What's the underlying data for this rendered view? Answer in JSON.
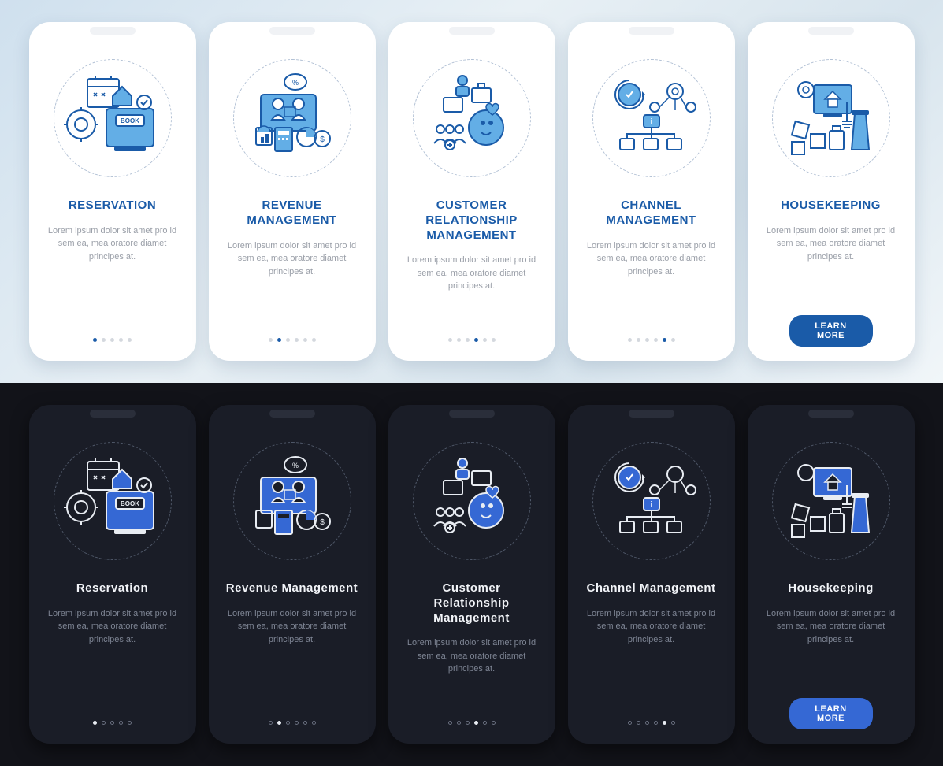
{
  "colors": {
    "accent": "#1a5ba8",
    "accentDark": "#3568d4"
  },
  "cards": [
    {
      "id": "reservation",
      "title_light": "RESERVATION",
      "title_dark": "Reservation",
      "desc": "Lorem ipsum dolor sit amet pro id sem ea, mea oratore diamet principes at.",
      "dots": 5,
      "active": 0,
      "cta": false
    },
    {
      "id": "revenue",
      "title_light": "REVENUE MANAGEMENT",
      "title_dark": "Revenue Management",
      "desc": "Lorem ipsum dolor sit amet pro id sem ea, mea oratore diamet principes at.",
      "dots": 6,
      "active": 1,
      "cta": false
    },
    {
      "id": "crm",
      "title_light": "CUSTOMER RELATIONSHIP MANAGEMENT",
      "title_dark": "Customer Relationship Management",
      "desc": "Lorem ipsum dolor sit amet pro id sem ea, mea oratore diamet principes at.",
      "dots": 6,
      "active": 3,
      "cta": false
    },
    {
      "id": "channel",
      "title_light": "CHANNEL MANAGEMENT",
      "title_dark": "Channel Management",
      "desc": "Lorem ipsum dolor sit amet pro id sem ea, mea oratore diamet principes at.",
      "dots": 6,
      "active": 4,
      "cta": false
    },
    {
      "id": "housekeeping",
      "title_light": "HOUSEKEEPING",
      "title_dark": "Housekeeping",
      "desc": "Lorem ipsum dolor sit amet pro id sem ea, mea oratore diamet principes at.",
      "dots": 0,
      "active": -1,
      "cta": true
    }
  ],
  "cta_label": "LEARN MORE"
}
